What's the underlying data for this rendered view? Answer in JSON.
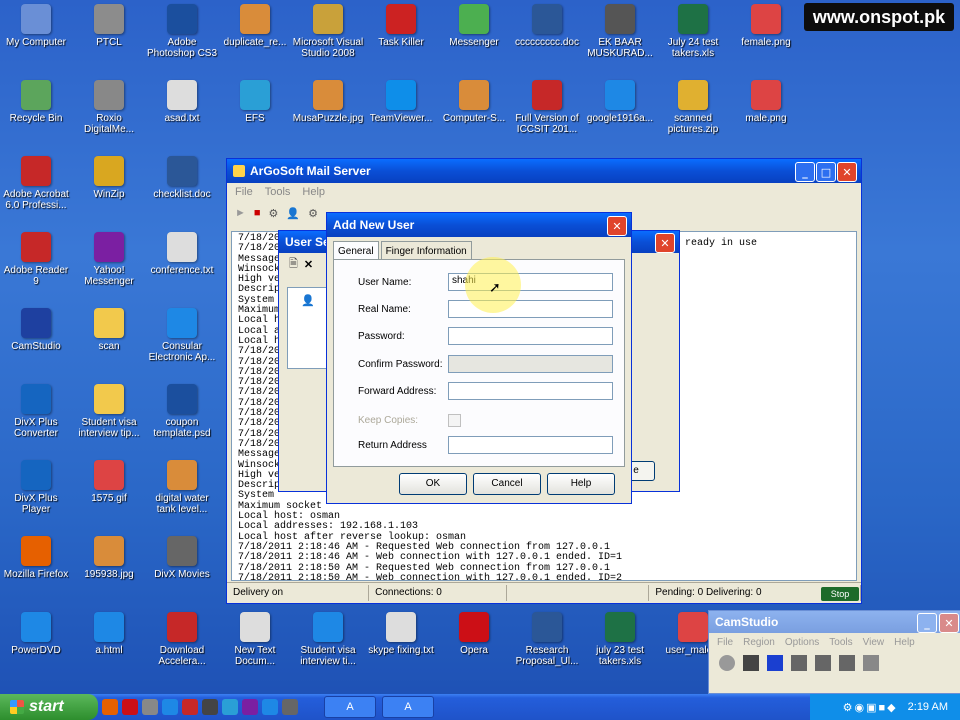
{
  "watermark": "www.onspot.pk",
  "desktop_icons": [
    {
      "label": "My Computer",
      "icon": "computer-icon",
      "color": "#6a8fd6"
    },
    {
      "label": "PTCL",
      "icon": "network-icon",
      "color": "#8c8c8c"
    },
    {
      "label": "Adobe Photoshop CS3",
      "icon": "photoshop-icon",
      "color": "#1b4f9e"
    },
    {
      "label": "duplicate_re...",
      "icon": "file-icon",
      "color": "#d98c3a"
    },
    {
      "label": "Microsoft Visual Studio 2008",
      "icon": "visual-studio-icon",
      "color": "#c9a13a"
    },
    {
      "label": "Task Killer",
      "icon": "skull-icon",
      "color": "#cc2222"
    },
    {
      "label": "Messenger",
      "icon": "messenger-icon",
      "color": "#4caf50"
    },
    {
      "label": "ccccccccc.doc",
      "icon": "word-doc-icon",
      "color": "#2b5797"
    },
    {
      "label": "EK BAAR MUSKURAD...",
      "icon": "media-icon",
      "color": "#555555"
    },
    {
      "label": "July 24 test takers.xls",
      "icon": "excel-icon",
      "color": "#1e7145"
    },
    {
      "label": "female.png",
      "icon": "image-icon",
      "color": "#dd4444"
    },
    {
      "label": "Recycle Bin",
      "icon": "recycle-bin-icon",
      "color": "#5ca55c"
    },
    {
      "label": "Roxio DigitalMe...",
      "icon": "disc-icon",
      "color": "#888888"
    },
    {
      "label": "asad.txt",
      "icon": "text-file-icon",
      "color": "#dddddd"
    },
    {
      "label": "EFS",
      "icon": "efs-icon",
      "color": "#2a9fd6"
    },
    {
      "label": "MusaPuzzle.jpg",
      "icon": "image-icon",
      "color": "#d98c3a"
    },
    {
      "label": "TeamViewer...",
      "icon": "teamviewer-icon",
      "color": "#0e8ee9"
    },
    {
      "label": "Computer-S...",
      "icon": "file-icon",
      "color": "#d98c3a"
    },
    {
      "label": "Full Version of ICCSIT 201...",
      "icon": "pdf-icon",
      "color": "#c62828"
    },
    {
      "label": "google1916a...",
      "icon": "ie-icon",
      "color": "#1e88e5"
    },
    {
      "label": "scanned pictures.zip",
      "icon": "zip-icon",
      "color": "#e0b030"
    },
    {
      "label": "male.png",
      "icon": "image-icon",
      "color": "#dd4444"
    },
    {
      "label": "Adobe Acrobat 6.0 Professi...",
      "icon": "acrobat-icon",
      "color": "#c62828"
    },
    {
      "label": "WinZip",
      "icon": "winzip-icon",
      "color": "#d9a720"
    },
    {
      "label": "checklist.doc",
      "icon": "word-doc-icon",
      "color": "#2b5797"
    },
    {
      "label": "Adobe Reader 9",
      "icon": "reader-icon",
      "color": "#c62828"
    },
    {
      "label": "Yahoo! Messenger",
      "icon": "yahoo-icon",
      "color": "#7b1fa2"
    },
    {
      "label": "conference.txt",
      "icon": "text-file-icon",
      "color": "#dddddd"
    },
    {
      "label": "CamStudio",
      "icon": "camstudio-icon",
      "color": "#1e40a0"
    },
    {
      "label": "scan",
      "icon": "folder-icon",
      "color": "#f2c94c"
    },
    {
      "label": "Consular Electronic Ap...",
      "icon": "ie-icon",
      "color": "#1e88e5"
    },
    {
      "label": "DivX Plus Converter",
      "icon": "divx-icon",
      "color": "#1565c0"
    },
    {
      "label": "Student visa interview tip...",
      "icon": "folder-icon",
      "color": "#f2c94c"
    },
    {
      "label": "coupon template.psd",
      "icon": "psd-icon",
      "color": "#1b4f9e"
    },
    {
      "label": "DivX Plus Player",
      "icon": "divx-player-icon",
      "color": "#1565c0"
    },
    {
      "label": "1575.gif",
      "icon": "image-icon",
      "color": "#dd4444"
    },
    {
      "label": "digital water tank level...",
      "icon": "file-icon",
      "color": "#d98c3a"
    },
    {
      "label": "Mozilla Firefox",
      "icon": "firefox-icon",
      "color": "#e66000"
    },
    {
      "label": "195938.jpg",
      "icon": "image-icon",
      "color": "#d98c3a"
    },
    {
      "label": "DivX Movies",
      "icon": "divx-movies-icon",
      "color": "#666666"
    },
    {
      "label": "PowerDVD",
      "icon": "powerdvd-icon",
      "color": "#1e88e5"
    },
    {
      "label": "a.html",
      "icon": "ie-icon",
      "color": "#1e88e5"
    },
    {
      "label": "Download Accelera...",
      "icon": "download-icon",
      "color": "#c62828"
    },
    {
      "label": "New Text Docum...",
      "icon": "text-file-icon",
      "color": "#dddddd"
    },
    {
      "label": "Student visa interview ti...",
      "icon": "ie-icon",
      "color": "#1e88e5"
    },
    {
      "label": "skype fixing.txt",
      "icon": "text-file-icon",
      "color": "#dddddd"
    },
    {
      "label": "Opera",
      "icon": "opera-icon",
      "color": "#cc0f16"
    },
    {
      "label": "Research Proposal_Ul...",
      "icon": "word-doc-icon",
      "color": "#2b5797"
    },
    {
      "label": "july 23 test takers.xls",
      "icon": "excel-icon",
      "color": "#1e7145"
    },
    {
      "label": "user_male...",
      "icon": "image-icon",
      "color": "#dd4444"
    }
  ],
  "mail_server": {
    "title": "ArGoSoft Mail Server",
    "menu": [
      "File",
      "Tools",
      "Help"
    ],
    "log_lines": [
      "7/18/20",
      "7/18/20",
      "Message",
      "Winsock",
      "High ve",
      "Descrip",
      "System",
      "Maximum",
      "Local h",
      "Local a",
      "Local h",
      "7/18/20",
      "7/18/20",
      "7/18/20",
      "7/18/20",
      "7/18/20",
      "7/18/20",
      "7/18/20",
      "7/18/20",
      "7/18/20",
      "7/18/20",
      "Message",
      "Winsock",
      "High ve",
      "Descrip",
      "System",
      "Maximum socket",
      "Local host: osman",
      "Local addresses: 192.168.1.103",
      "Local host after reverse lookup: osman",
      "7/18/2011 2:18:46 AM - Requested Web connection from 127.0.0.1",
      "7/18/2011 2:18:46 AM - Web connection with 127.0.0.1 ended. ID=1",
      "7/18/2011 2:18:50 AM - Requested Web connection from 127.0.0.1",
      "7/18/2011 2:18:50 AM - Web connection with 127.0.0.1 ended. ID=2"
    ],
    "log_ready": "ready in use",
    "status": {
      "delivery": "Delivery on",
      "connections": "Connections: 0",
      "pending": "Pending: 0 Delivering: 0"
    },
    "stop_label": "Stop"
  },
  "user_settings": {
    "title": "User Se",
    "close_btn": "e"
  },
  "add_user": {
    "title": "Add New User",
    "tabs": [
      "General",
      "Finger Information"
    ],
    "fields": {
      "user_name": {
        "label": "User Name:",
        "value": "shahi"
      },
      "real_name": {
        "label": "Real Name:",
        "value": ""
      },
      "password": {
        "label": "Password:",
        "value": ""
      },
      "confirm_password": {
        "label": "Confirm Password:",
        "value": ""
      },
      "forward_address": {
        "label": "Forward Address:",
        "value": ""
      },
      "keep_copies": {
        "label": "Keep Copies:"
      },
      "return_address": {
        "label": "Return Address",
        "value": ""
      }
    },
    "buttons": {
      "ok": "OK",
      "cancel": "Cancel",
      "help": "Help"
    }
  },
  "camstudio": {
    "title": "CamStudio",
    "menu": [
      "File",
      "Region",
      "Options",
      "Tools",
      "View",
      "Help"
    ]
  },
  "taskbar": {
    "start_label": "start",
    "tasks": [
      "A",
      "A"
    ],
    "clock": "2:19 AM"
  }
}
